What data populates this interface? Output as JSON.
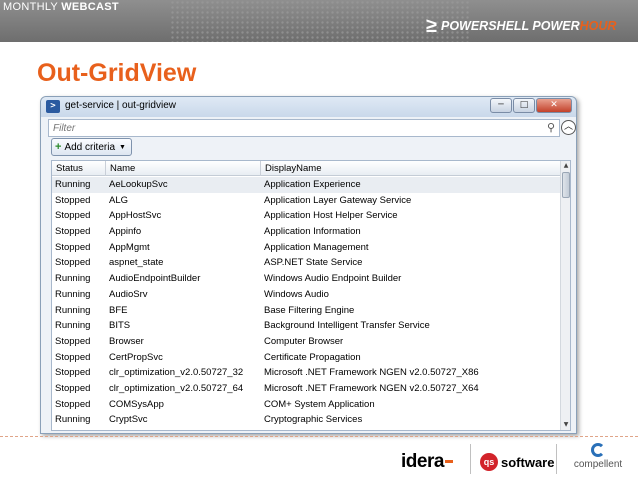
{
  "banner": {
    "prefix": "MONTHLY ",
    "suffix": "WEBCAST",
    "brand_main": "POWERSHELL POWER",
    "brand_accent": "HOUR"
  },
  "slide": {
    "title": "Out-GridView"
  },
  "window": {
    "title": "get-service | out-gridview",
    "filter_placeholder": "Filter",
    "add_criteria_label": "Add criteria",
    "columns": [
      "Status",
      "Name",
      "DisplayName"
    ],
    "rows": [
      {
        "status": "Running",
        "name": "AeLookupSvc",
        "display": "Application Experience"
      },
      {
        "status": "Stopped",
        "name": "ALG",
        "display": "Application Layer Gateway Service"
      },
      {
        "status": "Stopped",
        "name": "AppHostSvc",
        "display": "Application Host Helper Service"
      },
      {
        "status": "Stopped",
        "name": "Appinfo",
        "display": "Application Information"
      },
      {
        "status": "Stopped",
        "name": "AppMgmt",
        "display": "Application Management"
      },
      {
        "status": "Stopped",
        "name": "aspnet_state",
        "display": "ASP.NET State Service"
      },
      {
        "status": "Running",
        "name": "AudioEndpointBuilder",
        "display": "Windows Audio Endpoint Builder"
      },
      {
        "status": "Running",
        "name": "AudioSrv",
        "display": "Windows Audio"
      },
      {
        "status": "Running",
        "name": "BFE",
        "display": "Base Filtering Engine"
      },
      {
        "status": "Running",
        "name": "BITS",
        "display": "Background Intelligent Transfer Service"
      },
      {
        "status": "Stopped",
        "name": "Browser",
        "display": "Computer Browser"
      },
      {
        "status": "Stopped",
        "name": "CertPropSvc",
        "display": "Certificate Propagation"
      },
      {
        "status": "Stopped",
        "name": "clr_optimization_v2.0.50727_32",
        "display": "Microsoft .NET Framework NGEN v2.0.50727_X86"
      },
      {
        "status": "Stopped",
        "name": "clr_optimization_v2.0.50727_64",
        "display": "Microsoft .NET Framework NGEN v2.0.50727_X64"
      },
      {
        "status": "Stopped",
        "name": "COMSysApp",
        "display": "COM+ System Application"
      },
      {
        "status": "Running",
        "name": "CryptSvc",
        "display": "Cryptographic Services"
      }
    ]
  },
  "footer": {
    "idera": "idera",
    "quest_mark": "qs",
    "quest_text": "software",
    "compellent": "compellent"
  },
  "icons": {
    "powershell": "powershell-icon",
    "search": "search-icon",
    "collapse": "collapse-up-icon",
    "plus": "plus-icon",
    "dropdown": "dropdown-arrow-icon"
  },
  "colors": {
    "accent": "#e8601c",
    "banner": "#7a7a7a"
  }
}
